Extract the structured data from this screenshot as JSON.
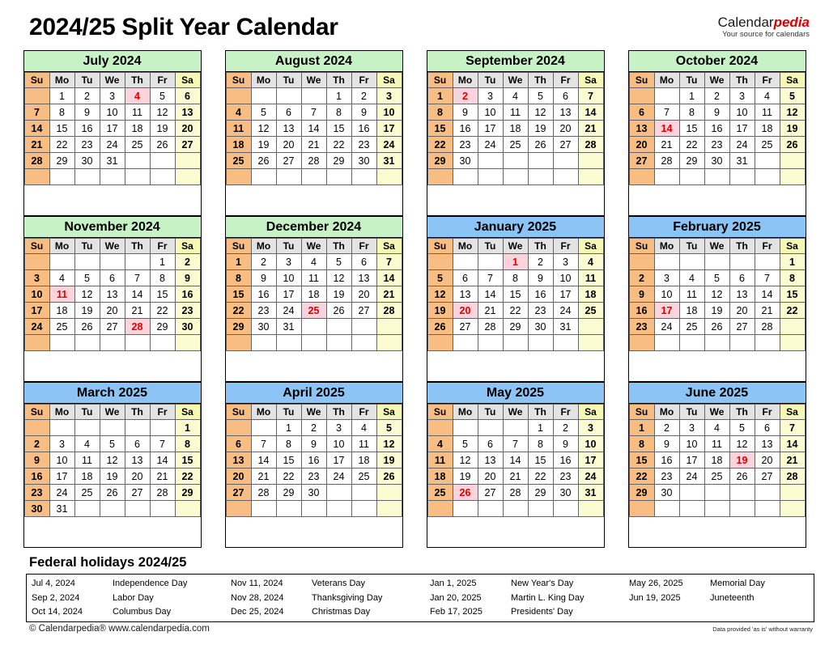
{
  "header": {
    "title": "2024/25 Split Year Calendar",
    "brand_first": "Calendar",
    "brand_second": "pedia",
    "brand_tagline": "Your source for calendars"
  },
  "colors": {
    "header_2024": "#c6f2c6",
    "header_2025": "#8cc4f5",
    "sunday_column": "#f7bd82",
    "saturday_column": "#fbfbd2",
    "weekday_header": "#e3e3e3",
    "holiday_background": "#fbd3dc",
    "holiday_text": "#e00000"
  },
  "weekday_labels": [
    "Su",
    "Mo",
    "Tu",
    "We",
    "Th",
    "Fr",
    "Sa"
  ],
  "months": [
    {
      "name": "July 2024",
      "year_class": "y2024",
      "weeks": [
        [
          "",
          "1",
          "2",
          "3",
          "4",
          "5",
          "6"
        ],
        [
          "7",
          "8",
          "9",
          "10",
          "11",
          "12",
          "13"
        ],
        [
          "14",
          "15",
          "16",
          "17",
          "18",
          "19",
          "20"
        ],
        [
          "21",
          "22",
          "23",
          "24",
          "25",
          "26",
          "27"
        ],
        [
          "28",
          "29",
          "30",
          "31",
          "",
          "",
          ""
        ],
        [
          "",
          "",
          "",
          "",
          "",
          "",
          ""
        ]
      ],
      "holidays": [
        "4"
      ]
    },
    {
      "name": "August 2024",
      "year_class": "y2024",
      "weeks": [
        [
          "",
          "",
          "",
          "",
          "1",
          "2",
          "3"
        ],
        [
          "4",
          "5",
          "6",
          "7",
          "8",
          "9",
          "10"
        ],
        [
          "11",
          "12",
          "13",
          "14",
          "15",
          "16",
          "17"
        ],
        [
          "18",
          "19",
          "20",
          "21",
          "22",
          "23",
          "24"
        ],
        [
          "25",
          "26",
          "27",
          "28",
          "29",
          "30",
          "31"
        ],
        [
          "",
          "",
          "",
          "",
          "",
          "",
          ""
        ]
      ],
      "holidays": []
    },
    {
      "name": "September 2024",
      "year_class": "y2024",
      "weeks": [
        [
          "1",
          "2",
          "3",
          "4",
          "5",
          "6",
          "7"
        ],
        [
          "8",
          "9",
          "10",
          "11",
          "12",
          "13",
          "14"
        ],
        [
          "15",
          "16",
          "17",
          "18",
          "19",
          "20",
          "21"
        ],
        [
          "22",
          "23",
          "24",
          "25",
          "26",
          "27",
          "28"
        ],
        [
          "29",
          "30",
          "",
          "",
          "",
          "",
          ""
        ],
        [
          "",
          "",
          "",
          "",
          "",
          "",
          ""
        ]
      ],
      "holidays": [
        "2"
      ]
    },
    {
      "name": "October 2024",
      "year_class": "y2024",
      "weeks": [
        [
          "",
          "",
          "1",
          "2",
          "3",
          "4",
          "5"
        ],
        [
          "6",
          "7",
          "8",
          "9",
          "10",
          "11",
          "12"
        ],
        [
          "13",
          "14",
          "15",
          "16",
          "17",
          "18",
          "19"
        ],
        [
          "20",
          "21",
          "22",
          "23",
          "24",
          "25",
          "26"
        ],
        [
          "27",
          "28",
          "29",
          "30",
          "31",
          "",
          ""
        ],
        [
          "",
          "",
          "",
          "",
          "",
          "",
          ""
        ]
      ],
      "holidays": [
        "14"
      ]
    },
    {
      "name": "November 2024",
      "year_class": "y2024",
      "weeks": [
        [
          "",
          "",
          "",
          "",
          "",
          "1",
          "2"
        ],
        [
          "3",
          "4",
          "5",
          "6",
          "7",
          "8",
          "9"
        ],
        [
          "10",
          "11",
          "12",
          "13",
          "14",
          "15",
          "16"
        ],
        [
          "17",
          "18",
          "19",
          "20",
          "21",
          "22",
          "23"
        ],
        [
          "24",
          "25",
          "26",
          "27",
          "28",
          "29",
          "30"
        ],
        [
          "",
          "",
          "",
          "",
          "",
          "",
          ""
        ]
      ],
      "holidays": [
        "11",
        "28"
      ]
    },
    {
      "name": "December 2024",
      "year_class": "y2024",
      "weeks": [
        [
          "1",
          "2",
          "3",
          "4",
          "5",
          "6",
          "7"
        ],
        [
          "8",
          "9",
          "10",
          "11",
          "12",
          "13",
          "14"
        ],
        [
          "15",
          "16",
          "17",
          "18",
          "19",
          "20",
          "21"
        ],
        [
          "22",
          "23",
          "24",
          "25",
          "26",
          "27",
          "28"
        ],
        [
          "29",
          "30",
          "31",
          "",
          "",
          "",
          ""
        ],
        [
          "",
          "",
          "",
          "",
          "",
          "",
          ""
        ]
      ],
      "holidays": [
        "25"
      ]
    },
    {
      "name": "January 2025",
      "year_class": "y2025",
      "weeks": [
        [
          "",
          "",
          "",
          "1",
          "2",
          "3",
          "4"
        ],
        [
          "5",
          "6",
          "7",
          "8",
          "9",
          "10",
          "11"
        ],
        [
          "12",
          "13",
          "14",
          "15",
          "16",
          "17",
          "18"
        ],
        [
          "19",
          "20",
          "21",
          "22",
          "23",
          "24",
          "25"
        ],
        [
          "26",
          "27",
          "28",
          "29",
          "30",
          "31",
          ""
        ],
        [
          "",
          "",
          "",
          "",
          "",
          "",
          ""
        ]
      ],
      "holidays": [
        "1",
        "20"
      ]
    },
    {
      "name": "February 2025",
      "year_class": "y2025",
      "weeks": [
        [
          "",
          "",
          "",
          "",
          "",
          "",
          "1"
        ],
        [
          "2",
          "3",
          "4",
          "5",
          "6",
          "7",
          "8"
        ],
        [
          "9",
          "10",
          "11",
          "12",
          "13",
          "14",
          "15"
        ],
        [
          "16",
          "17",
          "18",
          "19",
          "20",
          "21",
          "22"
        ],
        [
          "23",
          "24",
          "25",
          "26",
          "27",
          "28",
          ""
        ],
        [
          "",
          "",
          "",
          "",
          "",
          "",
          ""
        ]
      ],
      "holidays": [
        "17"
      ]
    },
    {
      "name": "March 2025",
      "year_class": "y2025",
      "weeks": [
        [
          "",
          "",
          "",
          "",
          "",
          "",
          "1"
        ],
        [
          "2",
          "3",
          "4",
          "5",
          "6",
          "7",
          "8"
        ],
        [
          "9",
          "10",
          "11",
          "12",
          "13",
          "14",
          "15"
        ],
        [
          "16",
          "17",
          "18",
          "19",
          "20",
          "21",
          "22"
        ],
        [
          "23",
          "24",
          "25",
          "26",
          "27",
          "28",
          "29"
        ],
        [
          "30",
          "31",
          "",
          "",
          "",
          "",
          ""
        ]
      ],
      "holidays": []
    },
    {
      "name": "April 2025",
      "year_class": "y2025",
      "weeks": [
        [
          "",
          "",
          "1",
          "2",
          "3",
          "4",
          "5"
        ],
        [
          "6",
          "7",
          "8",
          "9",
          "10",
          "11",
          "12"
        ],
        [
          "13",
          "14",
          "15",
          "16",
          "17",
          "18",
          "19"
        ],
        [
          "20",
          "21",
          "22",
          "23",
          "24",
          "25",
          "26"
        ],
        [
          "27",
          "28",
          "29",
          "30",
          "",
          "",
          ""
        ],
        [
          "",
          "",
          "",
          "",
          "",
          "",
          ""
        ]
      ],
      "holidays": []
    },
    {
      "name": "May 2025",
      "year_class": "y2025",
      "weeks": [
        [
          "",
          "",
          "",
          "",
          "1",
          "2",
          "3"
        ],
        [
          "4",
          "5",
          "6",
          "7",
          "8",
          "9",
          "10"
        ],
        [
          "11",
          "12",
          "13",
          "14",
          "15",
          "16",
          "17"
        ],
        [
          "18",
          "19",
          "20",
          "21",
          "22",
          "23",
          "24"
        ],
        [
          "25",
          "26",
          "27",
          "28",
          "29",
          "30",
          "31"
        ],
        [
          "",
          "",
          "",
          "",
          "",
          "",
          ""
        ]
      ],
      "holidays": [
        "26"
      ]
    },
    {
      "name": "June 2025",
      "year_class": "y2025",
      "weeks": [
        [
          "1",
          "2",
          "3",
          "4",
          "5",
          "6",
          "7"
        ],
        [
          "8",
          "9",
          "10",
          "11",
          "12",
          "13",
          "14"
        ],
        [
          "15",
          "16",
          "17",
          "18",
          "19",
          "20",
          "21"
        ],
        [
          "22",
          "23",
          "24",
          "25",
          "26",
          "27",
          "28"
        ],
        [
          "29",
          "30",
          "",
          "",
          "",
          "",
          ""
        ],
        [
          "",
          "",
          "",
          "",
          "",
          "",
          ""
        ]
      ],
      "holidays": [
        "19"
      ]
    }
  ],
  "footer": {
    "holidays_heading": "Federal holidays 2024/25",
    "holiday_rows": [
      [
        {
          "date": "Jul 4, 2024",
          "name": "Independence Day"
        },
        {
          "date": "Nov 11, 2024",
          "name": "Veterans Day"
        },
        {
          "date": "Jan 1, 2025",
          "name": "New Year's Day"
        },
        {
          "date": "May 26, 2025",
          "name": "Memorial Day"
        }
      ],
      [
        {
          "date": "Sep 2, 2024",
          "name": "Labor Day"
        },
        {
          "date": "Nov 28, 2024",
          "name": "Thanksgiving Day"
        },
        {
          "date": "Jan 20, 2025",
          "name": "Martin L. King Day"
        },
        {
          "date": "Jun 19, 2025",
          "name": "Juneteenth"
        }
      ],
      [
        {
          "date": "Oct 14, 2024",
          "name": "Columbus Day"
        },
        {
          "date": "Dec 25, 2024",
          "name": "Christmas Day"
        },
        {
          "date": "Feb 17, 2025",
          "name": "Presidents' Day"
        },
        {
          "date": "",
          "name": ""
        }
      ]
    ],
    "copyright": "© Calendarpedia®   www.calendarpedia.com",
    "disclaimer": "Data provided 'as is' without warranty"
  }
}
